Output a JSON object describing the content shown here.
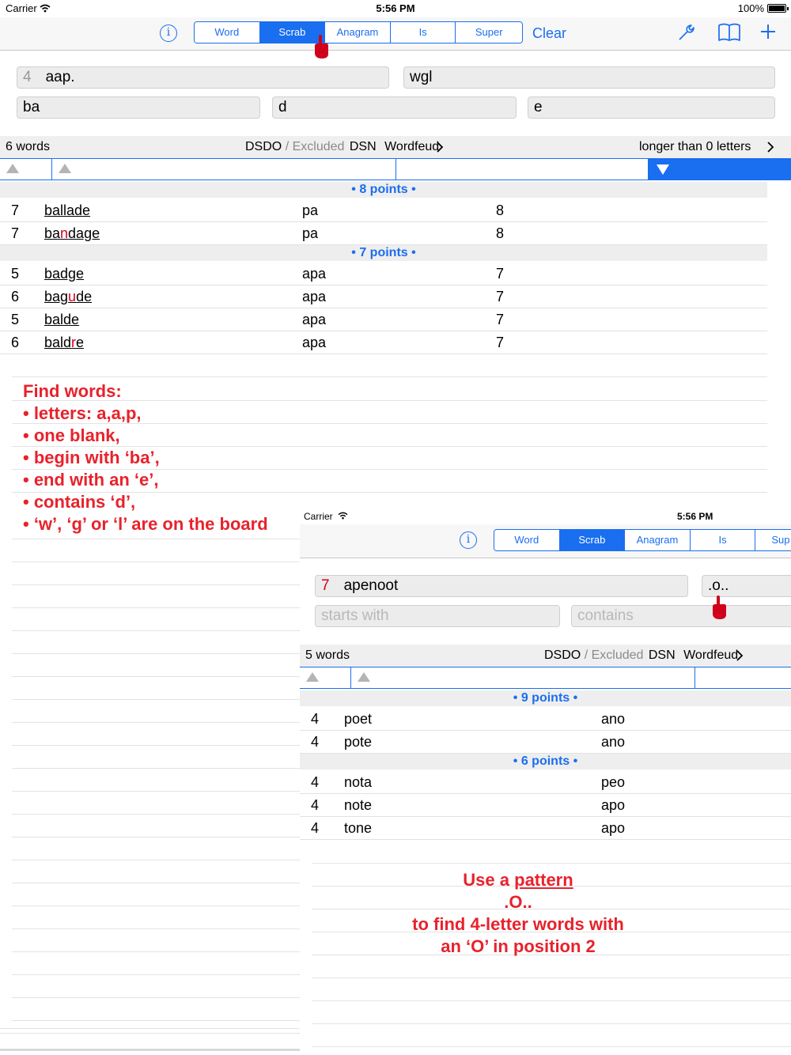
{
  "status": {
    "carrier": "Carrier",
    "time": "5:56 PM",
    "battery": "100%"
  },
  "toolbar": {
    "tabs": [
      "Word",
      "Scrab",
      "Anagram",
      "Is",
      "Super"
    ],
    "active_tab": "Scrab",
    "clear_label": "Clear",
    "info_label": "i"
  },
  "search": {
    "count": "4",
    "letters": "aap.",
    "board": "wgl",
    "starts_with": "ba",
    "contains": "d",
    "ends_with": "e"
  },
  "results": {
    "count_label": "6 words",
    "dict": "DSDO",
    "slash": "/",
    "excluded": "Excluded",
    "dsn": "DSN",
    "game": "Wordfeud",
    "length_filter": "longer than 0 letters"
  },
  "groups": [
    {
      "label": "• 8 points •",
      "rows": [
        {
          "len": "7",
          "pre": "ba",
          "mid": "l",
          "post": "lade",
          "rest": "pa",
          "pts": "8"
        },
        {
          "len": "7",
          "pre": "ba",
          "mid": "n",
          "post": "dage",
          "rest": "pa",
          "pts": "8"
        }
      ]
    },
    {
      "label": "• 7 points •",
      "rows": [
        {
          "len": "5",
          "pre": "badge",
          "mid": "",
          "post": "",
          "rest": "apa",
          "pts": "7"
        },
        {
          "len": "6",
          "pre": "bag",
          "mid": "u",
          "post": "de",
          "rest": "apa",
          "pts": "7"
        },
        {
          "len": "5",
          "pre": "bal",
          "mid": "",
          "post": "de",
          "rest": "apa",
          "pts": "7"
        },
        {
          "len": "6",
          "pre": "bald",
          "mid": "r",
          "post": "e",
          "rest": "apa",
          "pts": "7"
        }
      ]
    }
  ],
  "annotation1": [
    "Find words:",
    "• letters: a,a,p,",
    "• one blank,",
    "• begin with ‘ba’,",
    "• end with an ‘e’,",
    "• contains ‘d’,",
    "• ‘w’, ‘g’ or ‘l’ are on the board"
  ],
  "panel2": {
    "status": {
      "carrier": "Carrier",
      "time": "5:56 PM"
    },
    "tabs": [
      "Word",
      "Scrab",
      "Anagram",
      "Is",
      "Sup"
    ],
    "active_tab": "Scrab",
    "search": {
      "count": "7",
      "letters": "apenoot",
      "pattern": ".o..",
      "starts_placeholder": "starts with",
      "contains_placeholder": "contains"
    },
    "results": {
      "count_label": "5 words",
      "dict": "DSDO",
      "slash": "/",
      "excluded": "Excluded",
      "dsn": "DSN",
      "game": "Wordfeud"
    },
    "groups": [
      {
        "label": "• 9 points •",
        "rows": [
          {
            "len": "4",
            "word": "poet",
            "rest": "ano"
          },
          {
            "len": "4",
            "word": "pote",
            "rest": "ano"
          }
        ]
      },
      {
        "label": "• 6 points •",
        "rows": [
          {
            "len": "4",
            "word": "nota",
            "rest": "peo"
          },
          {
            "len": "4",
            "word": "note",
            "rest": "apo"
          },
          {
            "len": "4",
            "word": "tone",
            "rest": "apo"
          }
        ]
      }
    ],
    "annotation": {
      "line1_pre": "Use a ",
      "line1_link": "pattern",
      "line2": ".O..",
      "line3": "to find 4-letter words with",
      "line4": "an ‘O’ in position 2"
    }
  },
  "colors": {
    "accent": "#1a6ef0",
    "annotation": "#e8222c",
    "highlight": "#d0021b"
  }
}
